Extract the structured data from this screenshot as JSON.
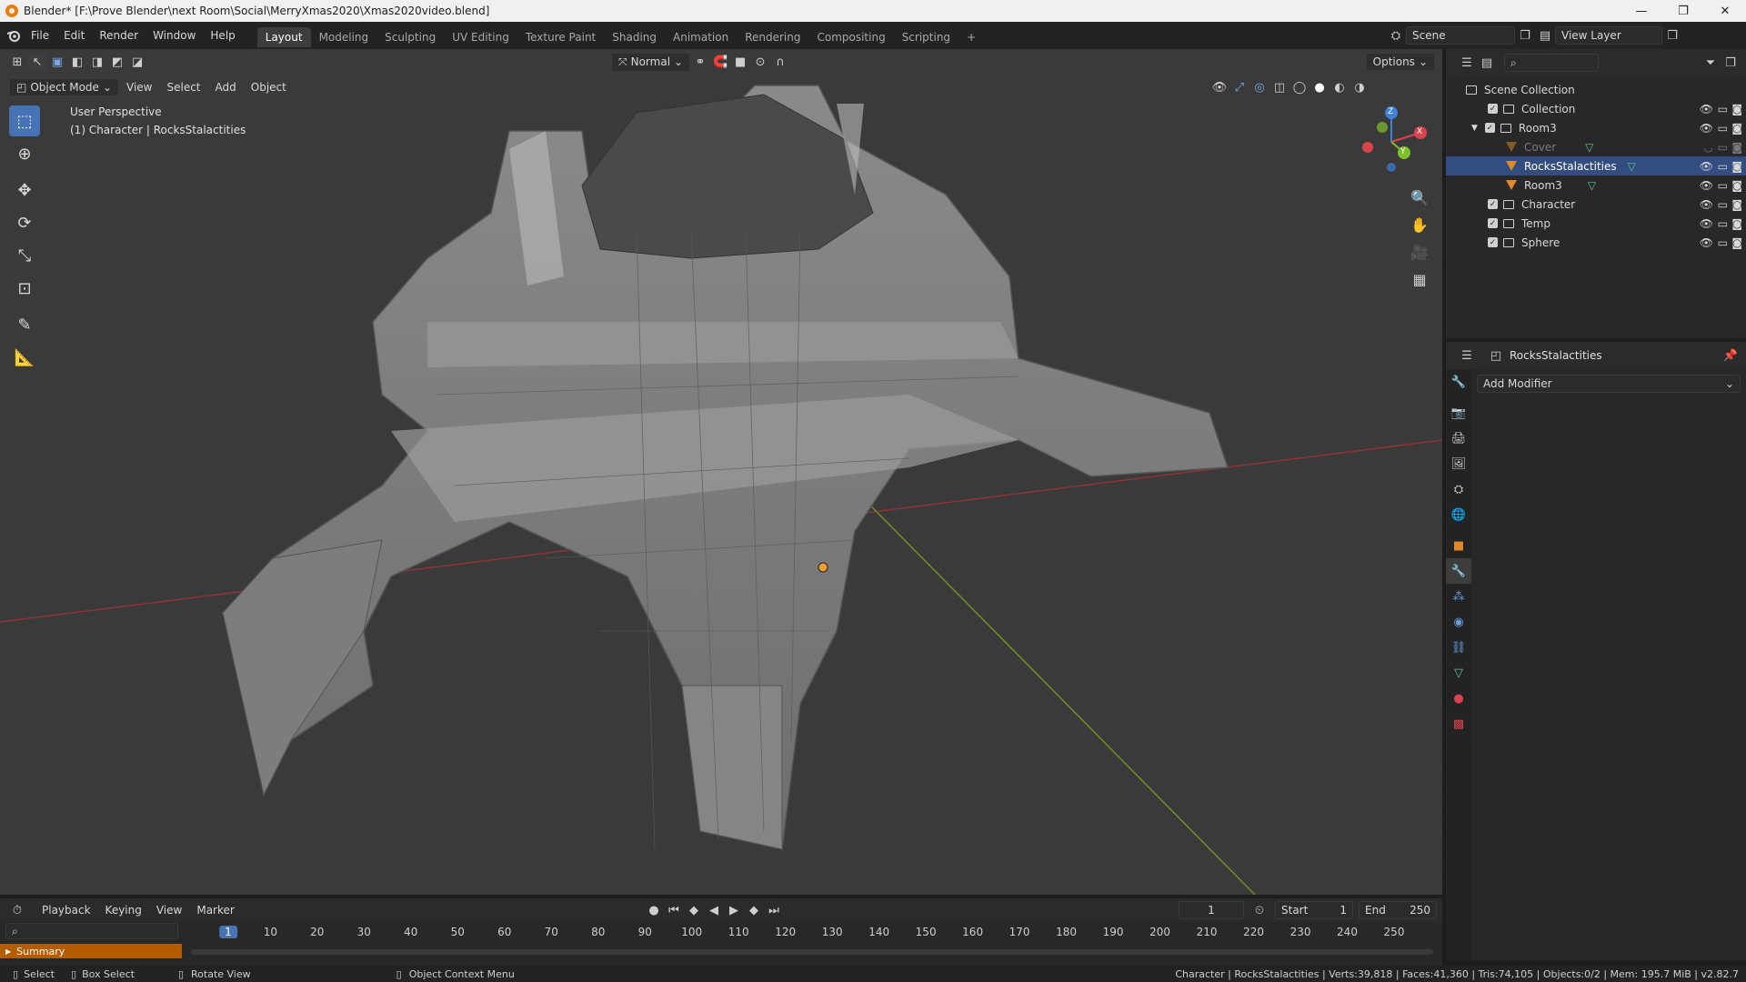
{
  "window": {
    "title": "Blender* [F:\\Prove Blender\\next Room\\Social\\MerryXmas2020\\Xmas2020video.blend]",
    "controls": [
      "—",
      "❐",
      "✕"
    ]
  },
  "menu": {
    "items": [
      "File",
      "Edit",
      "Render",
      "Window",
      "Help"
    ]
  },
  "workspaces": [
    "Layout",
    "Modeling",
    "Sculpting",
    "UV Editing",
    "Texture Paint",
    "Shading",
    "Animation",
    "Rendering",
    "Compositing",
    "Scripting",
    "+"
  ],
  "scene": {
    "label": "Scene"
  },
  "view_layer": {
    "label": "View Layer"
  },
  "viewport": {
    "transform_orientation": "Normal",
    "options_label": "Options",
    "mode": "Object Mode",
    "menus": [
      "View",
      "Select",
      "Add",
      "Object"
    ],
    "perspective_label": "User Perspective",
    "object_label": "(1) Character | RocksStalactities",
    "gizmo_axes": {
      "x": "X",
      "y": "Y",
      "z": "Z"
    },
    "colors": {
      "background": "#3a3a3a",
      "x_axis": "#b8383b",
      "y_axis": "#7aa22a",
      "accent": "#4772b3"
    }
  },
  "outliner": {
    "root": "Scene Collection",
    "items": [
      {
        "name": "Collection",
        "type": "collection"
      },
      {
        "name": "Room3",
        "type": "collection",
        "expanded": true
      },
      {
        "name": "Cover",
        "type": "object",
        "dim": true
      },
      {
        "name": "RocksStalactities",
        "type": "object",
        "selected": true
      },
      {
        "name": "Room3",
        "type": "object"
      },
      {
        "name": "Character",
        "type": "collection"
      },
      {
        "name": "Temp",
        "type": "collection"
      },
      {
        "name": "Sphere",
        "type": "collection"
      }
    ]
  },
  "properties": {
    "object_name": "RocksStalactities",
    "add_modifier": "Add Modifier"
  },
  "timeline": {
    "menus": [
      "Playback",
      "Keying",
      "View",
      "Marker"
    ],
    "current_frame": "1",
    "start_label": "Start",
    "start": "1",
    "end_label": "End",
    "end": "250",
    "ticks": [
      "1",
      "10",
      "20",
      "30",
      "40",
      "50",
      "60",
      "70",
      "80",
      "90",
      "100",
      "110",
      "120",
      "130",
      "140",
      "150",
      "160",
      "170",
      "180",
      "190",
      "200",
      "210",
      "220",
      "230",
      "240",
      "250"
    ],
    "summary": "Summary"
  },
  "status": {
    "select": "Select",
    "box_select": "Box Select",
    "rotate_view": "Rotate View",
    "context_menu": "Object Context Menu",
    "stats": "Character | RocksStalactities | Verts:39,818 | Faces:41,360 | Tris:74,105 | Objects:0/2 | Mem: 195.7 MiB | v2.82.7"
  }
}
